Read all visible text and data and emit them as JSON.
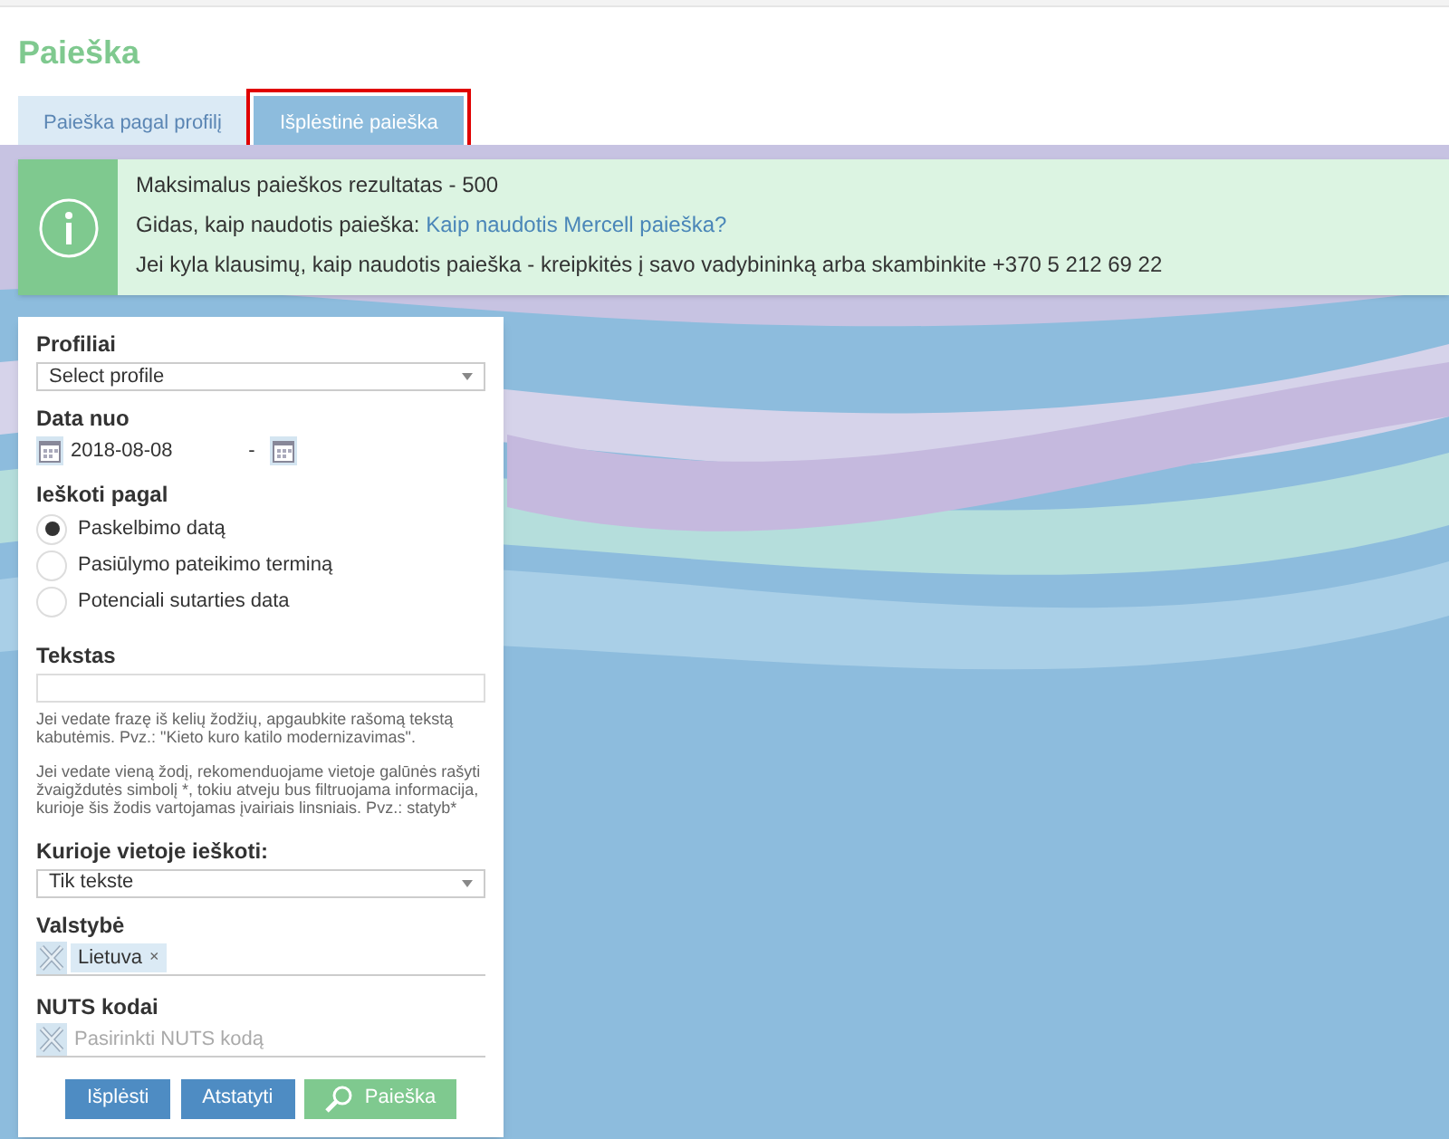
{
  "page_title": "Paieška",
  "tabs": [
    {
      "label": "Paieška pagal profilį",
      "selected": false,
      "highlighted": false
    },
    {
      "label": "Išplėstinė paieška",
      "selected": true,
      "highlighted": true
    }
  ],
  "info": {
    "lines": [
      {
        "kind": "text",
        "text": "Maksimalus paieškos rezultatas - 500"
      },
      {
        "kind": "link",
        "text": "Gidas, kaip naudotis paieška: ",
        "link": "Kaip naudotis Mercell paieška?"
      },
      {
        "kind": "text",
        "text": "Jei kyla klausimų, kaip naudotis paieška - kreipkitės į savo vadybininką arba skambinkite +370 5 212 69 22"
      }
    ]
  },
  "form": {
    "profiles": {
      "label": "Profiliai",
      "value": "Select profile"
    },
    "date": {
      "label": "Data nuo",
      "from": "2018-08-08",
      "separator": "-"
    },
    "search_by": {
      "label": "Ieškoti pagal",
      "options": [
        {
          "label": "Paskelbimo datą",
          "selected": true
        },
        {
          "label": "Pasiūlymo pateikimo terminą",
          "selected": false
        },
        {
          "label": "Potenciali sutarties data",
          "selected": false
        }
      ]
    },
    "text": {
      "label": "Tekstas",
      "hints": [
        "Jei vedate frazę iš kelių žodžių, apgaubkite rašomą tekstą kabutėmis. Pvz.: \"Kieto kuro katilo modernizavimas\".",
        "Jei vedate vieną žodį, rekomenduojame vietoje galūnės rašyti žvaigždutės simbolį *, tokiu atveju bus filtruojama informacija, kurioje šis žodis vartojamas įvairiais linsniais. Pvz.: statyb*"
      ]
    },
    "where": {
      "label": "Kurioje vietoje ieškoti:",
      "value": "Tik tekste"
    },
    "country": {
      "label": "Valstybė",
      "tags": [
        {
          "text": "Lietuva",
          "remove": "×"
        }
      ]
    },
    "nuts": {
      "label": "NUTS kodai",
      "placeholder": "Pasirinkti NUTS kodą"
    },
    "buttons": [
      {
        "kind": "blue",
        "label": "Išplėsti"
      },
      {
        "kind": "blue",
        "label": "Atstatyti"
      },
      {
        "kind": "search",
        "label": "Paieška"
      }
    ]
  }
}
